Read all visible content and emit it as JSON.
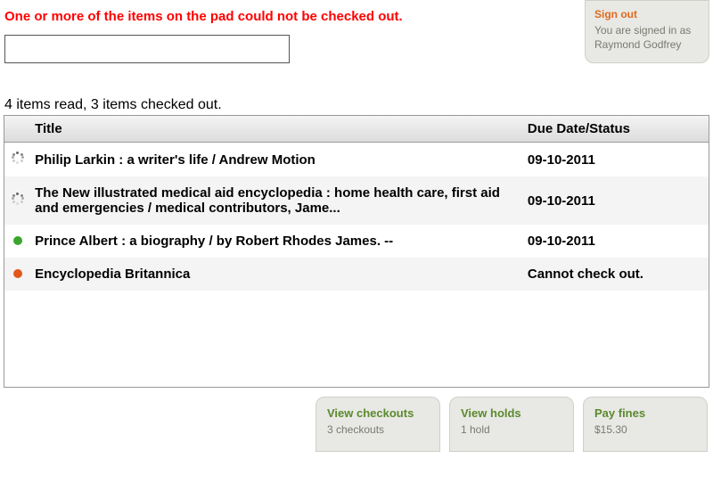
{
  "error_message": "One or more of the items on the pad could not be checked out.",
  "sign_out": {
    "link": "Sign out",
    "text": "You are signed in as Raymond Godfrey"
  },
  "input_value": "",
  "summary": "4 items read, 3 items checked out.",
  "table": {
    "headers": {
      "title": "Title",
      "due": "Due Date/Status"
    },
    "rows": [
      {
        "status": "loading",
        "title": "Philip Larkin : a writer's life / Andrew Motion",
        "due": "09-10-2011"
      },
      {
        "status": "loading",
        "title": "The New illustrated medical aid encyclopedia : home health care, first aid and emergencies / medical contributors, Jame...",
        "due": "09-10-2011"
      },
      {
        "status": "ok",
        "title": "Prince Albert : a biography / by Robert Rhodes James. --",
        "due": "09-10-2011"
      },
      {
        "status": "error",
        "title": "Encyclopedia Britannica",
        "due": "Cannot check out."
      }
    ]
  },
  "buttons": {
    "checkouts": {
      "title": "View checkouts",
      "sub": "3 checkouts"
    },
    "holds": {
      "title": "View holds",
      "sub": "1 hold"
    },
    "fines": {
      "title": "Pay fines",
      "sub": "$15.30"
    }
  }
}
